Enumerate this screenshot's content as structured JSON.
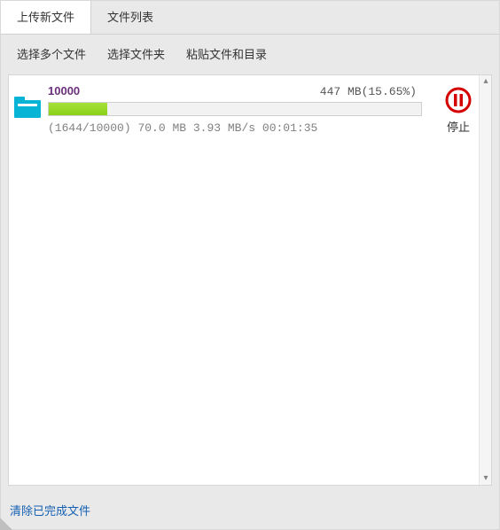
{
  "tabs": {
    "upload_new": "上传新文件",
    "file_list": "文件列表"
  },
  "toolbar": {
    "select_multiple": "选择多个文件",
    "select_folder": "选择文件夹",
    "paste": "粘贴文件和目录"
  },
  "upload": {
    "name": "10000",
    "size_text": "447 MB",
    "percent_text": "(15.65%)",
    "percent_value": 15.65,
    "progress_count": "(1644/10000)",
    "uploaded_size": "70.0 MB",
    "speed": "3.93 MB/s",
    "eta": "00:01:35",
    "stop_label": "停止"
  },
  "footer": {
    "clear_completed": "清除已完成文件"
  },
  "colors": {
    "accent": "#07b4d6",
    "progress": "#8ad117",
    "stop": "#d40000",
    "link": "#1560b3",
    "filename": "#6b2f7a"
  }
}
